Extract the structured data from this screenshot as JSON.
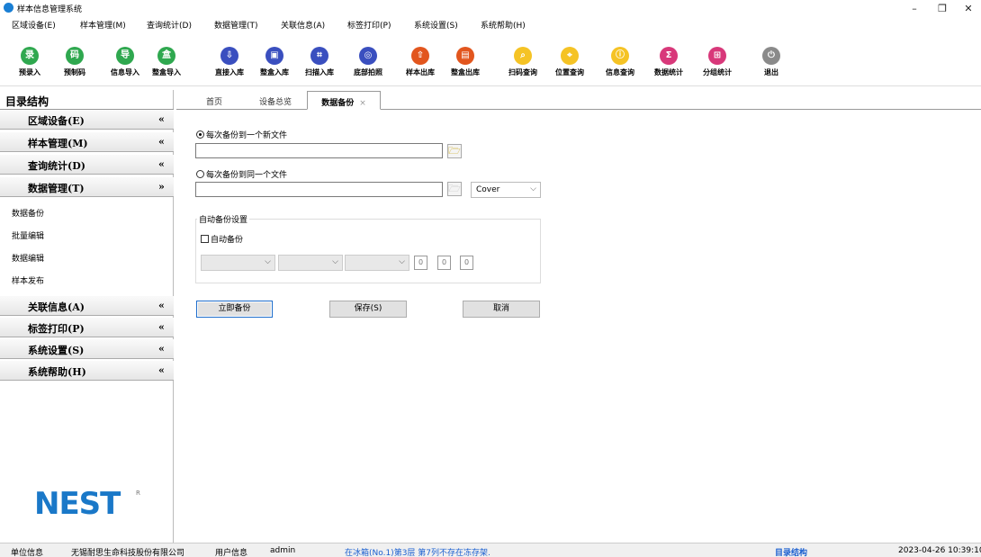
{
  "window": {
    "title": "样本信息管理系统",
    "controls": {
      "minimize": "–",
      "restore": "❐",
      "close": "✕"
    }
  },
  "menu": [
    "区域设备(E)",
    "样本管理(M)",
    "查询统计(D)",
    "数据管理(T)",
    "关联信息(A)",
    "标签打印(P)",
    "系统设置(S)",
    "系统帮助(H)"
  ],
  "toolbar": [
    {
      "label": "预录入",
      "icon": "pre-entry-icon",
      "color": "#2fa84f",
      "glyph": "录"
    },
    {
      "label": "预制码",
      "icon": "precode-icon",
      "color": "#2fa84f",
      "glyph": "码"
    },
    {
      "label": "信息导入",
      "icon": "import-icon",
      "color": "#2fa84f",
      "glyph": "导"
    },
    {
      "label": "整盒导入",
      "icon": "box-import-icon",
      "color": "#2fa84f",
      "glyph": "盒"
    },
    {
      "label": "直接入库",
      "icon": "direct-in-icon",
      "color": "#3a4fbf",
      "glyph": "⇩"
    },
    {
      "label": "整盒入库",
      "icon": "box-in-icon",
      "color": "#3a4fbf",
      "glyph": "▣"
    },
    {
      "label": "扫描入库",
      "icon": "scan-in-icon",
      "color": "#3a4fbf",
      "glyph": "⌗"
    },
    {
      "label": "底部拍照",
      "icon": "camera-icon",
      "color": "#3a4fbf",
      "glyph": "◎"
    },
    {
      "label": "样本出库",
      "icon": "sample-out-icon",
      "color": "#e2561e",
      "glyph": "⇧"
    },
    {
      "label": "整盒出库",
      "icon": "box-out-icon",
      "color": "#e2561e",
      "glyph": "▤"
    },
    {
      "label": "扫码查询",
      "icon": "scan-query-icon",
      "color": "#f5c325",
      "glyph": "⌕"
    },
    {
      "label": "位置查询",
      "icon": "location-query-icon",
      "color": "#f5c325",
      "glyph": "⌖"
    },
    {
      "label": "信息查询",
      "icon": "info-query-icon",
      "color": "#f5c325",
      "glyph": "ⓘ"
    },
    {
      "label": "数据统计",
      "icon": "stats-icon",
      "color": "#d8387a",
      "glyph": "Σ"
    },
    {
      "label": "分组统计",
      "icon": "group-stats-icon",
      "color": "#d8387a",
      "glyph": "⊞"
    },
    {
      "label": "退出",
      "icon": "power-icon",
      "color": "#8a8a8a",
      "glyph": "⏻"
    }
  ],
  "nav": {
    "header": "目录结构",
    "groups_top": [
      {
        "label": "区域设备(E)",
        "chevron": "«"
      },
      {
        "label": "样本管理(M)",
        "chevron": "«"
      },
      {
        "label": "查询统计(D)",
        "chevron": "«"
      },
      {
        "label": "数据管理(T)",
        "chevron": "»"
      }
    ],
    "sub_items": [
      "数据备份",
      "批量编辑",
      "数据编辑",
      "样本发布"
    ],
    "groups_bottom": [
      {
        "label": "关联信息(A)",
        "chevron": "«"
      },
      {
        "label": "标签打印(P)",
        "chevron": "«"
      },
      {
        "label": "系统设置(S)",
        "chevron": "«"
      },
      {
        "label": "系统帮助(H)",
        "chevron": "«"
      }
    ],
    "logo": {
      "text": "NEST",
      "mark": "R"
    }
  },
  "tabs": [
    {
      "label": "首页",
      "active": false
    },
    {
      "label": "设备总览",
      "active": false
    },
    {
      "label": "数据备份",
      "active": true,
      "close": "×"
    }
  ],
  "backup": {
    "option_new_file": "每次备份到一个新文件",
    "option_same_file": "每次备份到同一个文件",
    "new_file_path": "",
    "same_file_path": "",
    "mode_select": "Cover",
    "auto_group_title": "自动备份设置",
    "auto_checkbox": "自动备份",
    "num_values": [
      "0",
      "0",
      "0"
    ],
    "buttons": {
      "backup_now": "立即备份",
      "save": "保存(S)",
      "cancel": "取消"
    }
  },
  "status": {
    "unit_label": "单位信息",
    "unit_value": "无锡耐思生命科技股份有限公司",
    "user_label": "用户信息",
    "user_value": "admin",
    "message": "在冰箱(No.1)第3层 第7列不存在冻存架.",
    "nav_label": "目录结构",
    "datetime": "2023-04-26 10:39:10",
    "message_color": "#1a5fd0",
    "nav_label_color": "#1a5fd0"
  }
}
